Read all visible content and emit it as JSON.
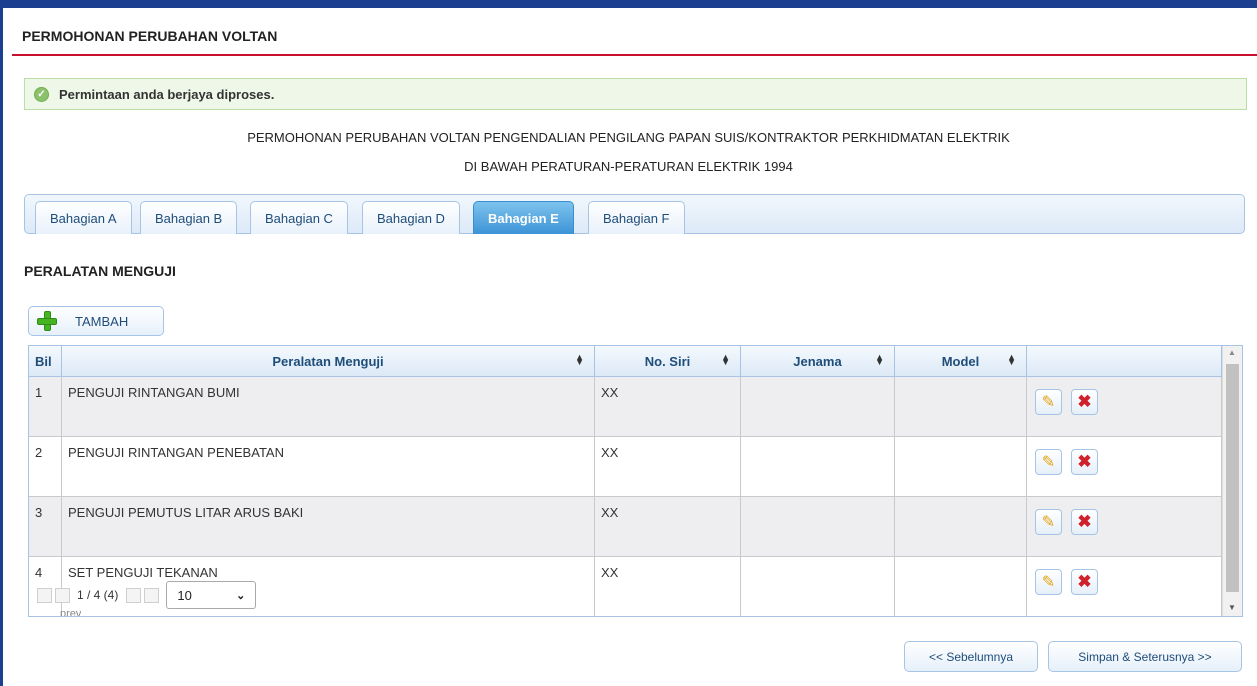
{
  "page": {
    "title": "PERMOHONAN PERUBAHAN VOLTAN",
    "alert_message": "Permintaan anda berjaya diproses.",
    "form_title_line1": "PERMOHONAN PERUBAHAN VOLTAN PENGENDALIAN PENGILANG PAPAN SUIS/KONTRAKTOR PERKHIDMATAN ELEKTRIK",
    "form_title_line2": "DI BAWAH PERATURAN-PERATURAN ELEKTRIK 1994"
  },
  "tabs": [
    {
      "label": "Bahagian A",
      "active": false
    },
    {
      "label": "Bahagian B",
      "active": false
    },
    {
      "label": "Bahagian C",
      "active": false
    },
    {
      "label": "Bahagian D",
      "active": false
    },
    {
      "label": "Bahagian E",
      "active": true
    },
    {
      "label": "Bahagian F",
      "active": false
    }
  ],
  "section": {
    "title": "PERALATAN MENGUJI",
    "add_label": "TAMBAH"
  },
  "table": {
    "headers": [
      "Bil",
      "Peralatan Menguji",
      "No. Siri",
      "Jenama",
      "Model",
      ""
    ],
    "rows": [
      [
        "1",
        "PENGUJI RINTANGAN BUMI",
        "XX",
        "",
        ""
      ],
      [
        "2",
        "PENGUJI RINTANGAN PENEBATAN",
        "XX",
        "",
        ""
      ],
      [
        "3",
        "PENGUJI PEMUTUS LITAR ARUS BAKI",
        "XX",
        "",
        ""
      ],
      [
        "4",
        "SET PENGUJI TEKANAN",
        "XX",
        "",
        ""
      ]
    ]
  },
  "pager": {
    "status": "1 / 4 (4)",
    "prev_alt": "prev",
    "page_size": "10"
  },
  "buttons": {
    "previous": "<< Sebelumnya",
    "save_next": "Simpan & Seterusnya >>"
  },
  "colors": {
    "header_bar": "#1d3f8f",
    "header_rule": "#c8102e",
    "active_tab": "#3c93d6",
    "success_bg": "#eef7e8"
  }
}
